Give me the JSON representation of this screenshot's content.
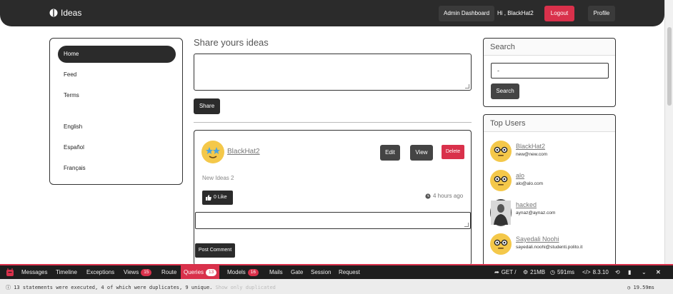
{
  "navbar": {
    "brand": "Ideas",
    "admin_dashboard": "Admin Dashboard",
    "greeting": "Hi , BlackHat2",
    "logout": "Logout",
    "profile": "Profile",
    "colors": {
      "bar": "#2b2b2b",
      "logout": "#d9314b"
    }
  },
  "sidebar": {
    "items": [
      {
        "label": "Home",
        "active": true
      },
      {
        "label": "Feed"
      },
      {
        "label": "Terms"
      },
      {
        "label": "English"
      },
      {
        "label": "Español"
      },
      {
        "label": "Français"
      }
    ]
  },
  "share": {
    "title": "Share yours ideas",
    "button": "Share"
  },
  "post": {
    "username": "BlackHat2",
    "edit": "Edit",
    "view": "View",
    "delete": "Delete",
    "text": "New Ideas 2",
    "like": "0 Like",
    "time": "4 hours ago",
    "post_comment": "Post Comment"
  },
  "search": {
    "title": "Search",
    "value": "-",
    "button": "Search"
  },
  "top_users": {
    "title": "Top Users",
    "users": [
      {
        "name": "BlackHat2",
        "email": "new@new.com",
        "avatar": "emoji-glasses"
      },
      {
        "name": "alo",
        "email": "alo@alo.com",
        "avatar": "emoji-glasses"
      },
      {
        "name": "hacked",
        "email": "aynaz@aynaz.com",
        "avatar": "photo"
      },
      {
        "name": "Sayedali Noohi",
        "email": "sayedali.noohi@studenti.polito.it",
        "avatar": "emoji-glasses"
      }
    ]
  },
  "debugbar": {
    "tabs": [
      {
        "label": "Messages"
      },
      {
        "label": "Timeline"
      },
      {
        "label": "Exceptions"
      },
      {
        "label": "Views",
        "badge": "15"
      },
      {
        "label": "Route"
      },
      {
        "label": "Queries",
        "badge": "13",
        "active": true
      },
      {
        "label": "Models",
        "badge": "16"
      },
      {
        "label": "Mails"
      },
      {
        "label": "Gate"
      },
      {
        "label": "Session"
      },
      {
        "label": "Request"
      }
    ],
    "method": "GET /",
    "memory": "21MB",
    "time": "591ms",
    "php": "8.3.10",
    "status_text": "13 statements were executed, 4 of which were duplicates, 9 unique.",
    "status_faded": "Show only duplicated",
    "total_time": "19.59ms",
    "accent": "#d9314b"
  }
}
